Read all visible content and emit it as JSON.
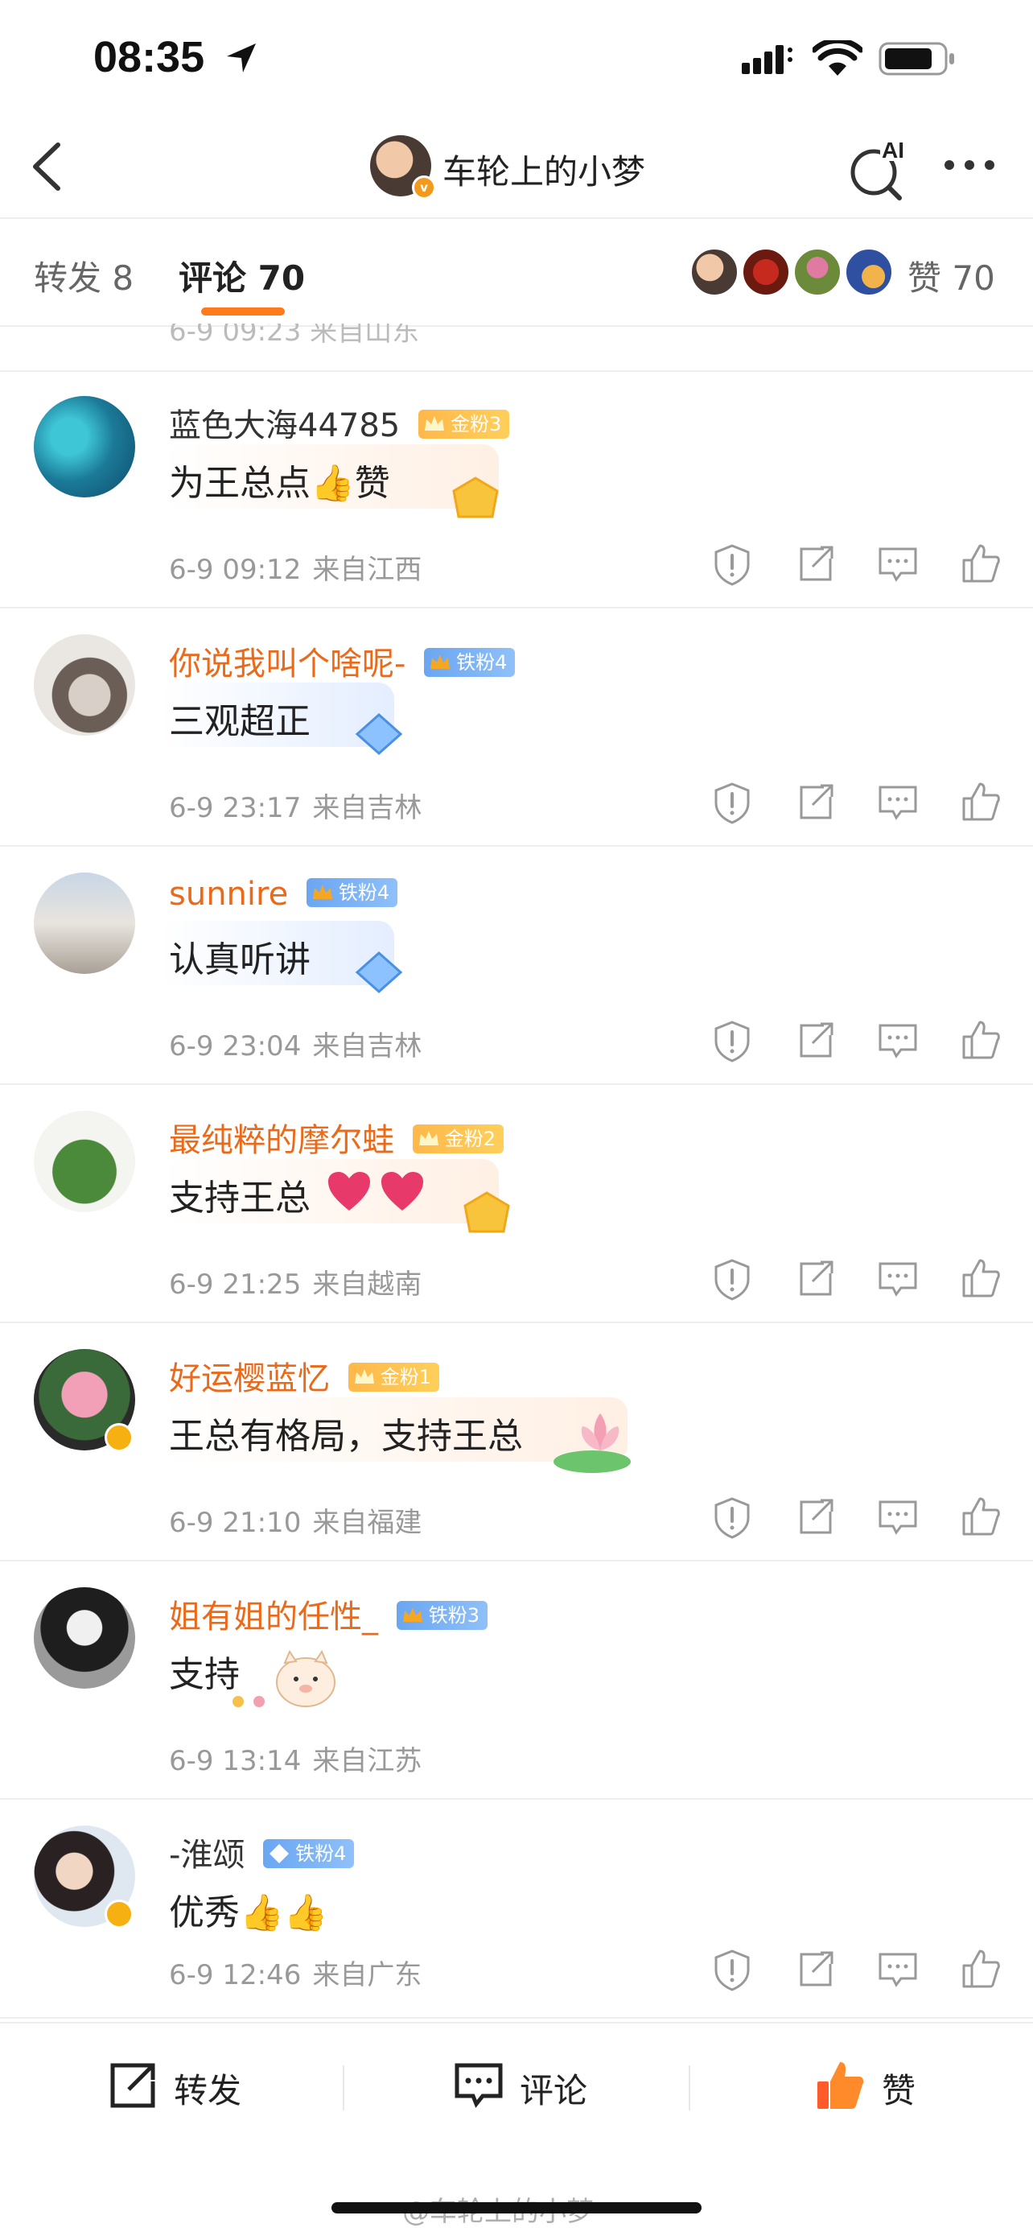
{
  "status_bar": {
    "time": "08:35"
  },
  "nav": {
    "title": "车轮上的小梦"
  },
  "tabs": {
    "repost": "转发 8",
    "comment": "评论 70",
    "like": "赞 70"
  },
  "partial_comment": {
    "meta": "6-9 09:23  来自山东"
  },
  "comments": [
    {
      "name": "蓝色大海44785",
      "fan_badge": "金粉3",
      "text": "为王总点👍赞",
      "date": "6-9 09:12",
      "location": "来自江西"
    },
    {
      "name": "你说我叫个啥呢-",
      "fan_badge": "铁粉4",
      "text": "三观超正",
      "date": "6-9 23:17",
      "location": "来自吉林"
    },
    {
      "name": "sunnire",
      "fan_badge": "铁粉4",
      "text": "认真听讲",
      "date": "6-9 23:04",
      "location": "来自吉林"
    },
    {
      "name": "最纯粹的摩尔蛙",
      "fan_badge": "金粉2",
      "text": "支持王总",
      "date": "6-9 21:25",
      "location": "来自越南"
    },
    {
      "name": "好运樱蓝忆",
      "fan_badge": "金粉1",
      "text": "王总有格局，支持王总",
      "date": "6-9 21:10",
      "location": "来自福建"
    },
    {
      "name": "姐有姐的任性_",
      "fan_badge": "铁粉3",
      "text": "支持",
      "date": "6-9 13:14",
      "location": "来自江苏"
    },
    {
      "name": "-淮颂",
      "fan_badge": "铁粉4",
      "text": "优秀👍👍",
      "date": "6-9 12:46",
      "location": "来自广东"
    }
  ],
  "bottom_bar": {
    "repost": "转发",
    "comment": "评论",
    "like": "赞"
  },
  "watermark": "@车轮上的小梦",
  "colors": {
    "accent": "#ff7a1a",
    "username_highlight": "#eb6a1a",
    "meta_text": "#999999"
  }
}
